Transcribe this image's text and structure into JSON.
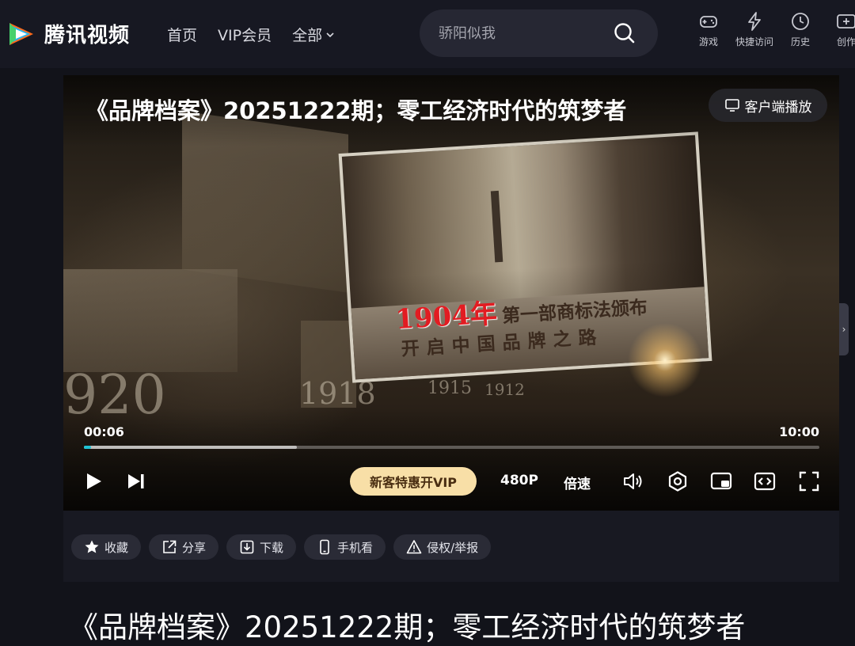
{
  "header": {
    "brand": "腾讯视频",
    "nav": [
      {
        "label": "首页"
      },
      {
        "label": "VIP会员"
      },
      {
        "label": "全部"
      }
    ],
    "search": {
      "placeholder": "骄阳似我"
    },
    "tools": [
      {
        "label": "游戏",
        "icon": "gamepad-icon"
      },
      {
        "label": "快捷访问",
        "icon": "lightning-icon"
      },
      {
        "label": "历史",
        "icon": "clock-icon"
      },
      {
        "label": "创作",
        "icon": "create-icon"
      }
    ]
  },
  "player": {
    "title": "《品牌档案》20251222期；零工经济时代的筑梦者",
    "client_button": "客户端播放",
    "frame": {
      "headline_year": "1904年",
      "headline_rest": "第一部商标法颁布",
      "headline_line2": "开启中国品牌之路",
      "ghost_years": [
        "920",
        "1918",
        "1915",
        "1912"
      ]
    },
    "time_current": "00:06",
    "time_total": "10:00",
    "progress": {
      "played": 0.01,
      "buffered": 0.29
    },
    "vip_button": "新客特惠开VIP",
    "quality": "480P",
    "speed": "倍速"
  },
  "actions": [
    {
      "label": "收藏",
      "icon": "star-icon",
      "name": "favorite-button"
    },
    {
      "label": "分享",
      "icon": "share-icon",
      "name": "share-button"
    },
    {
      "label": "下载",
      "icon": "download-icon",
      "name": "download-button"
    },
    {
      "label": "手机看",
      "icon": "phone-icon",
      "name": "mobile-watch-button"
    },
    {
      "label": "侵权/举报",
      "icon": "warning-icon",
      "name": "report-button"
    }
  ],
  "page_title": "《品牌档案》20251222期；零工经济时代的筑梦者",
  "colors": {
    "accent": "#1fc3d4",
    "vip": "#f8dfa7",
    "header_bg": "#171822"
  }
}
